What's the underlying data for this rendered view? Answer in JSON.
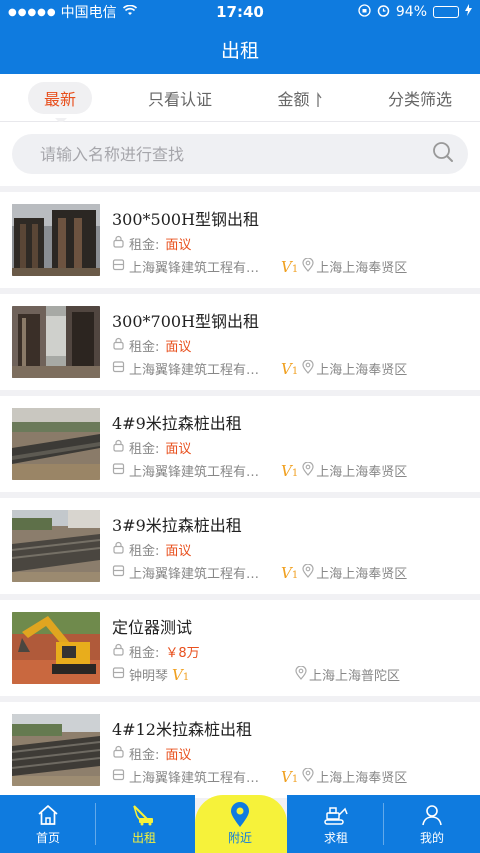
{
  "status_bar": {
    "carrier": "中国电信",
    "time": "17:40",
    "battery_text": "94%",
    "battery_level": 0.94
  },
  "header": {
    "title": "出租"
  },
  "filters": {
    "items": [
      {
        "label": "最新",
        "active": true
      },
      {
        "label": "只看认证"
      },
      {
        "label": "金额"
      },
      {
        "label": "分类筛选"
      }
    ]
  },
  "search": {
    "placeholder": "请输入名称进行查找"
  },
  "list": {
    "items": [
      {
        "title": "300*500H型钢出租",
        "rent_label": "租金:",
        "price": "面议",
        "company": "上海翼锋建筑工程有限公司",
        "badge": "V",
        "badge_sub": "1",
        "location": "上海上海奉贤区"
      },
      {
        "title": "300*700H型钢出租",
        "rent_label": "租金:",
        "price": "面议",
        "company": "上海翼锋建筑工程有限公司",
        "badge": "V",
        "badge_sub": "1",
        "location": "上海上海奉贤区"
      },
      {
        "title": "4#9米拉森桩出租",
        "rent_label": "租金:",
        "price": "面议",
        "company": "上海翼锋建筑工程有限公司",
        "badge": "V",
        "badge_sub": "1",
        "location": "上海上海奉贤区"
      },
      {
        "title": "3#9米拉森桩出租",
        "rent_label": "租金:",
        "price": "面议",
        "company": "上海翼锋建筑工程有限公司",
        "badge": "V",
        "badge_sub": "1",
        "location": "上海上海奉贤区"
      },
      {
        "title": "定位器测试",
        "rent_label": "租金:",
        "price": "￥8万",
        "company": "钟明琴",
        "badge": "V",
        "badge_sub": "1",
        "location": "上海上海普陀区"
      },
      {
        "title": "4#12米拉森桩出租",
        "rent_label": "租金:",
        "price": "面议",
        "company": "上海翼锋建筑工程有限公司",
        "badge": "V",
        "badge_sub": "1",
        "location": "上海上海奉贤区"
      }
    ]
  },
  "tabbar": {
    "items": [
      {
        "label": "首页",
        "icon": "home-icon"
      },
      {
        "label": "出租",
        "icon": "crane-icon",
        "active": true
      },
      {
        "label": "附近",
        "icon": "location-pin-icon"
      },
      {
        "label": "求租",
        "icon": "excavator-icon"
      },
      {
        "label": "我的",
        "icon": "user-icon"
      }
    ]
  },
  "colors": {
    "brand_blue": "#0f7bdf",
    "accent_orange": "#e8501e",
    "highlight_yellow": "#f6f23a",
    "badge_gold": "#f0a020"
  }
}
